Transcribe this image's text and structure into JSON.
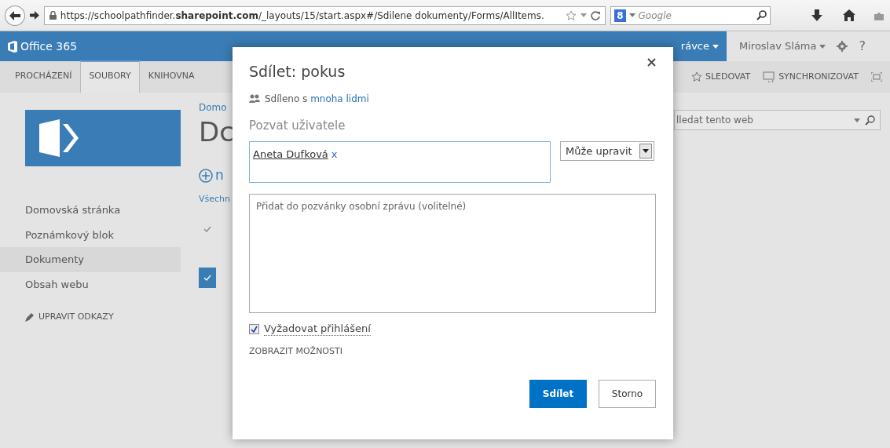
{
  "browser": {
    "url": "https://schoolpathfinder.**sharepoint.com**/_layouts/15/start.aspx#/Sdilene dokumenty/Forms/AllItems.",
    "search_badge": "8",
    "search_placeholder": "Google"
  },
  "suite_bar": {
    "brand": "Office 365",
    "admin_menu": "rávce",
    "user_menu": "Miroslav Sláma",
    "help": "?"
  },
  "ribbon": {
    "tabs": [
      {
        "label": "PROCHÁZENÍ",
        "selected": false
      },
      {
        "label": "SOUBORY",
        "selected": true
      },
      {
        "label": "KNIHOVNA",
        "selected": false
      }
    ],
    "actions": [
      {
        "kind": "follow",
        "label": "SLEDOVAT"
      },
      {
        "kind": "sync",
        "label": "SYNCHRONIZOVAT"
      }
    ]
  },
  "sidebar": {
    "items": [
      {
        "label": "Domovská stránka",
        "selected": false
      },
      {
        "label": "Poznámkový blok",
        "selected": false
      },
      {
        "label": "Dokumenty",
        "selected": true
      },
      {
        "label": "Obsah webu",
        "selected": false
      }
    ],
    "edit_links": "UPRAVIT ODKAZY"
  },
  "main": {
    "breadcrumb": "Domo",
    "title": "Dc",
    "new_label": "n",
    "view_label": "Všechn",
    "rows": [
      {
        "selected": false
      },
      {
        "selected": true
      }
    ]
  },
  "search": {
    "placeholder": "lledat tento web"
  },
  "dialog": {
    "title": "Sdílet: pokus",
    "shared_text": "Sdíleno s ",
    "shared_link": "mnoha lidmi",
    "invite_label": "Pozvat uživatele",
    "invitees": [
      {
        "name": "Aneta Dufková",
        "remove": "x"
      }
    ],
    "permission": "Může upravit",
    "message_placeholder": "Přidat do pozvánky osobní zprávu (volitelné)",
    "require_signin": {
      "label": "Vyžadovat přihlášení",
      "checked": true
    },
    "show_options": "ZOBRAZIT MOŽNOSTI",
    "buttons": [
      {
        "kind": "primary",
        "label": "Sdílet"
      },
      {
        "kind": "secondary",
        "label": "Storno"
      }
    ]
  }
}
